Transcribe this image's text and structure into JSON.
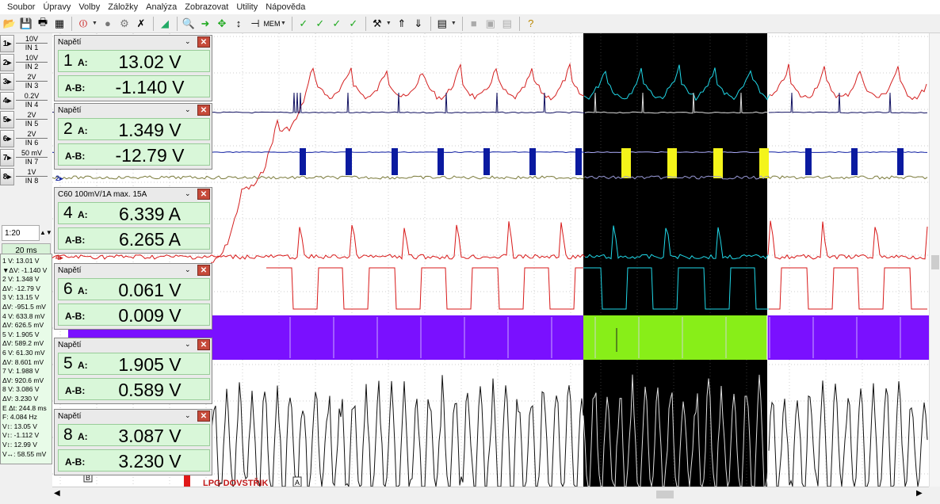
{
  "menu": [
    "Soubor",
    "Úpravy",
    "Volby",
    "Záložky",
    "Analýza",
    "Zobrazovat",
    "Utility",
    "Nápověda"
  ],
  "toolbar_icons": [
    "open-file-icon",
    "save-icon",
    "print-icon",
    "print-preview-icon",
    "stop-icon",
    "record-icon",
    "tool-icon",
    "clear-icon",
    "chart-icon",
    "zoom-icon",
    "run-icon",
    "navigate-icon",
    "cursor-icon",
    "marker-icon",
    "memory-icon",
    "settings-icon",
    "layout-icon",
    "disabled-icon",
    "disabled-icon",
    "help-icon"
  ],
  "channels": [
    {
      "button": "1",
      "range": "10V",
      "input": "IN 1"
    },
    {
      "button": "2",
      "range": "10V",
      "input": "IN 2"
    },
    {
      "button": "3",
      "range": "2V",
      "input": "IN 3"
    },
    {
      "button": "4",
      "range": "0.2V",
      "input": "IN 4"
    },
    {
      "button": "5",
      "range": "2V",
      "input": "IN 5"
    },
    {
      "button": "6",
      "range": "2V",
      "input": "IN 6"
    },
    {
      "button": "7",
      "range": "50 mV",
      "input": "IN 7"
    },
    {
      "button": "8",
      "range": "1V",
      "input": "IN 8"
    }
  ],
  "zoom": "1:20",
  "timebase": "20 ms",
  "measurements": [
    "1  V: 13.01 V",
    "▼ΔV: -1.140 V",
    "2  V: 1.348 V",
    "  ΔV: -12.79 V",
    "3  V: 13.15 V",
    "  ΔV: -951.5 mV",
    "4  V: 633.8 mV",
    "  ΔV: 626.5 mV",
    "5  V: 1.905 V",
    "  ΔV: 589.2 mV",
    "6  V: 61.30 mV",
    "  ΔV: 8.601 mV",
    "7  V: 1.988 V",
    "  ΔV: 920.6 mV",
    "8  V: 3.086 V",
    "  ΔV: 3.230 V",
    "E  Δt: 244.8 ms",
    "      F: 4.084 Hz",
    "V↕: 13.05 V",
    "V↕: -1.112 V",
    "V↕: 12.99 V",
    "V↔: 58.55 mV"
  ],
  "panels": [
    {
      "title": "Napětí",
      "num": "1",
      "a_label": "A:",
      "a_value": "13.02 V",
      "ab_label": "A-B:",
      "ab_value": "-1.140 V"
    },
    {
      "title": "Napětí",
      "num": "2",
      "a_label": "A:",
      "a_value": "1.349 V",
      "ab_label": "A-B:",
      "ab_value": "-12.79 V"
    },
    {
      "title": "C60 100mV/1A max. 15A",
      "num": "4",
      "a_label": "A:",
      "a_value": "6.339 A",
      "ab_label": "A-B:",
      "ab_value": "6.265 A"
    },
    {
      "title": "Napětí",
      "num": "6",
      "a_label": "A:",
      "a_value": "0.061 V",
      "ab_label": "A-B:",
      "ab_value": "0.009 V"
    },
    {
      "title": "Napětí",
      "num": "5",
      "a_label": "A:",
      "a_value": "1.905 V",
      "ab_label": "A-B:",
      "ab_value": "0.589 V"
    },
    {
      "title": "Napětí",
      "num": "8",
      "a_label": "A:",
      "a_value": "3.087 V",
      "ab_label": "A-B:",
      "ab_value": "3.230 V"
    }
  ],
  "close_glyph": "✕",
  "dropdown_glyph": "⌄",
  "scope": {
    "bottom_label": "LPG DOVSTŘIK",
    "cursor_a_label": "A",
    "cursor_b_label": "B",
    "marker_2_label": "2",
    "marker_4_label": "4",
    "colors": {
      "trace1_red": "#d42020",
      "trace_navy": "#101060",
      "trace_blue": "#0a1aa0",
      "trace_olive": "#7a7a3a",
      "trace_red2": "#d81818",
      "trace_purple": "#7a10ff",
      "trace_black": "#111111",
      "highlight_bg": "#000000",
      "highlight_cyan": "#20d8e8",
      "highlight_yellow": "#f4f41a",
      "highlight_green": "#88ee18"
    }
  }
}
